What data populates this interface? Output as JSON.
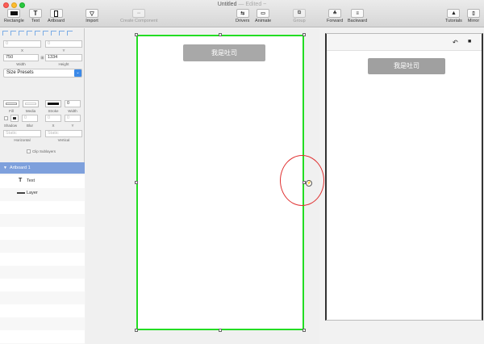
{
  "window": {
    "title": "Untitled",
    "edited": "— Edited ~"
  },
  "toolbar": {
    "left": [
      {
        "label": "Rectangle",
        "icon": "rectangle-icon"
      },
      {
        "label": "Text",
        "icon": "text-icon"
      },
      {
        "label": "Artboard",
        "icon": "artboard-icon"
      },
      {
        "label": "Import",
        "icon": "import-icon"
      },
      {
        "label": "Create Component",
        "icon": "component-icon"
      }
    ],
    "middle": [
      {
        "label": "Drivers",
        "icon": "drivers-icon"
      },
      {
        "label": "Animate",
        "icon": "animate-icon"
      },
      {
        "label": "Group",
        "icon": "group-icon"
      },
      {
        "label": "Forward",
        "icon": "forward-icon"
      },
      {
        "label": "Backward",
        "icon": "backward-icon"
      }
    ],
    "right": [
      {
        "label": "Tutorials",
        "icon": "tutorials-icon"
      },
      {
        "label": "Mirror",
        "icon": "mirror-icon"
      }
    ],
    "text_glyph": "T"
  },
  "inspector": {
    "x_label": "X",
    "y_label": "Y",
    "x_value": "0",
    "y_value": "0",
    "width_value": "750",
    "height_value": "1334",
    "width_label": "Width",
    "height_label": "Height",
    "size_presets": "Size Presets",
    "fill_label": "Fill",
    "media_label": "Media",
    "stroke_label": "Stroke",
    "stroke_width_value": "0",
    "stroke_width_label": "Width",
    "shadow_label": "Shadow",
    "blur_label": "Blur",
    "shadow_x_label": "X",
    "shadow_y_label": "Y",
    "blur_value": "0",
    "shadow_x_value": "0",
    "shadow_y_value": "0",
    "horizontal_value": "Static",
    "vertical_value": "Static",
    "horizontal_label": "Horizontal",
    "vertical_label": "Vertical",
    "clip_sublayers": "Clip Sublayers"
  },
  "layers": {
    "items": [
      {
        "name": "Artboard 1",
        "selected": true
      },
      {
        "name": "Text",
        "selected": false
      },
      {
        "name": "Layer",
        "selected": false
      }
    ]
  },
  "canvas": {
    "button_text": "我是吐司",
    "knob_glyph": "⚡"
  },
  "preview": {
    "button_text": "我是吐司",
    "back_glyph": "↶",
    "record_glyph": "■"
  },
  "colors": {
    "selection_green": "#22dd22",
    "annotation_red": "#e03030",
    "layer_selected": "#7ea0dc"
  }
}
